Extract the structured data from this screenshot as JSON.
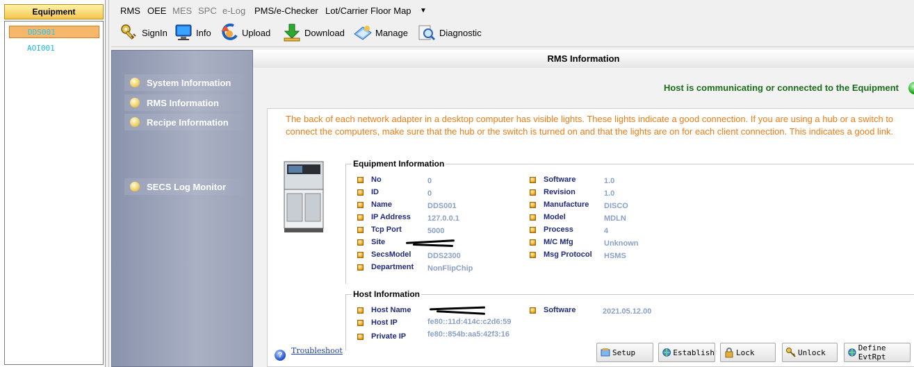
{
  "equipment_panel": {
    "header": "Equipment",
    "items": [
      {
        "id": "DDS001",
        "selected": true
      },
      {
        "id": "AOI001",
        "selected": false
      }
    ]
  },
  "menu": {
    "items": [
      {
        "label": "RMS",
        "enabled": true
      },
      {
        "label": "OEE",
        "enabled": true
      },
      {
        "label": "MES",
        "enabled": false
      },
      {
        "label": "SPC",
        "enabled": false
      },
      {
        "label": "e-Log",
        "enabled": false
      },
      {
        "label": "PMS/e-Checker",
        "enabled": true
      },
      {
        "label": "Lot/Carrier Floor Map",
        "enabled": true
      }
    ],
    "overflow_icon": "dropdown-arrow-icon"
  },
  "toolbar": {
    "items": [
      {
        "label": "SignIn",
        "icon": "key-icon"
      },
      {
        "label": "Info",
        "icon": "monitor-icon"
      },
      {
        "label": "Upload",
        "icon": "upload-arrow-icon"
      },
      {
        "label": "Download",
        "icon": "download-arrow-icon"
      },
      {
        "label": "Manage",
        "icon": "manage-icon"
      },
      {
        "label": "Diagnostic",
        "icon": "magnifier-icon"
      }
    ]
  },
  "nav": {
    "items": [
      {
        "label": "System Information"
      },
      {
        "label": "RMS Information"
      },
      {
        "label": "Recipe Information"
      },
      {
        "label": "SECS Log Monitor"
      }
    ]
  },
  "main": {
    "title": "RMS Information",
    "status": "Host is communicating or connected to the Equipment",
    "status_color": "#19a319",
    "description": "The back of each network adapter in a desktop computer has visible lights. These lights indicate a good connection. If you are using a hub or a switch to connect the computers, make sure that the hub or the switch is turned on and that the lights are on for each client connection. This indicates a good link."
  },
  "equipment_info": {
    "title": "Equipment Information",
    "left": [
      {
        "label": "No",
        "value": "0"
      },
      {
        "label": "ID",
        "value": "0"
      },
      {
        "label": "Name",
        "value": "DDS001"
      },
      {
        "label": "IP Address",
        "value": "127.0.0.1"
      },
      {
        "label": "Tcp Port",
        "value": "5000"
      },
      {
        "label": "Site",
        "value": ""
      },
      {
        "label": "SecsModel",
        "value": "DDS2300"
      },
      {
        "label": "Department",
        "value": "NonFlipChip"
      }
    ],
    "right": [
      {
        "label": "Software",
        "value": "1.0"
      },
      {
        "label": "Revision",
        "value": "1.0"
      },
      {
        "label": "Manufacture",
        "value": "DISCO"
      },
      {
        "label": "Model",
        "value": "MDLN"
      },
      {
        "label": "Process",
        "value": "4"
      },
      {
        "label": "M/C Mfg",
        "value": "Unknown"
      },
      {
        "label": "Msg Protocol",
        "value": "HSMS"
      }
    ]
  },
  "host_info": {
    "title": "Host Information",
    "left": [
      {
        "label": "Host Name",
        "value": ""
      },
      {
        "label": "Host IP",
        "value": "fe80::11d:414c:c2d6:59"
      },
      {
        "label": "Private IP",
        "value": "fe80::854b:aa5:42f3:16"
      }
    ],
    "right": [
      {
        "label": "Software",
        "value": "2021.05.12.00"
      }
    ]
  },
  "help": {
    "label": "Troubleshoot"
  },
  "buttons": [
    {
      "label": "Setup",
      "icon": "setup-icon"
    },
    {
      "label": "Establish",
      "icon": "globe-icon"
    },
    {
      "label": "Lock",
      "icon": "lock-icon"
    },
    {
      "label": "Unlock",
      "icon": "key-icon"
    },
    {
      "label": "Define EvtRpt",
      "icon": "globe-icon"
    }
  ]
}
